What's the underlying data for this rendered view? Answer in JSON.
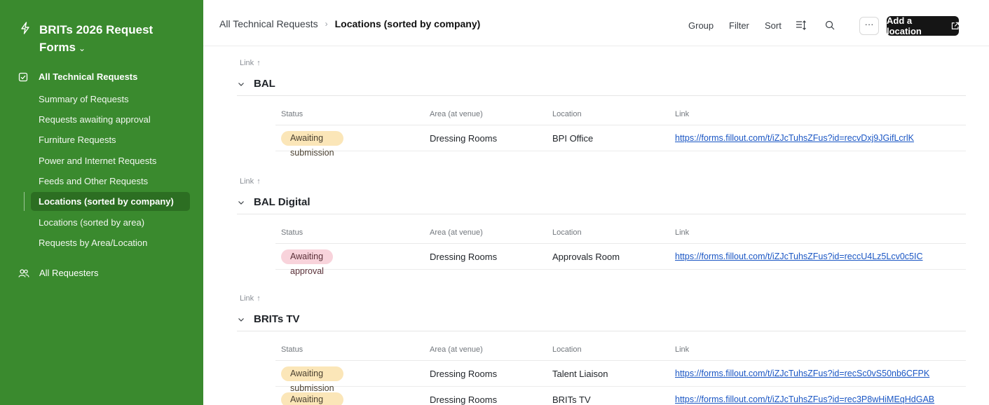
{
  "sidebar": {
    "app_title": "BRITs 2026 Request Forms",
    "app_caret": "⌄",
    "section_title": "All Technical Requests",
    "items": [
      {
        "label": "Summary of Requests"
      },
      {
        "label": "Requests awaiting approval"
      },
      {
        "label": "Furniture Requests"
      },
      {
        "label": "Power and Internet Requests"
      },
      {
        "label": "Feeds and Other Requests"
      },
      {
        "label": "Locations (sorted by company)"
      },
      {
        "label": "Locations (sorted by area)"
      },
      {
        "label": "Requests by Area/Location"
      }
    ],
    "active_item": "Locations (sorted by company)",
    "requesters_label": "All Requesters",
    "colors": {
      "background": "#3a8a2e",
      "active": "#2c6e22"
    }
  },
  "header": {
    "breadcrumb_parent": "All Technical Requests",
    "breadcrumb_current": "Locations (sorted by company)",
    "toolbar": {
      "group": "Group",
      "filter": "Filter",
      "sort": "Sort",
      "more": "···",
      "add": "Add a location"
    }
  },
  "columns": {
    "status": "Status",
    "area": "Area (at venue)",
    "location": "Location",
    "link": "Link"
  },
  "group_sort_label": "Link",
  "groups": [
    {
      "name": "BAL",
      "rows": [
        {
          "status": "Awaiting submission",
          "area": "Dressing Rooms",
          "location": "BPI Office",
          "link": "https://forms.fillout.com/t/iZJcTuhsZFus?id=recvDxj9JGifLcrlK"
        }
      ]
    },
    {
      "name": "BAL Digital",
      "rows": [
        {
          "status": "Awaiting approval",
          "area": "Dressing Rooms",
          "location": "Approvals Room",
          "link": "https://forms.fillout.com/t/iZJcTuhsZFus?id=reccU4Lz5Lcv0c5IC"
        }
      ]
    },
    {
      "name": "BRITs TV",
      "rows": [
        {
          "status": "Awaiting submission",
          "area": "Dressing Rooms",
          "location": "Talent Liaison",
          "link": "https://forms.fillout.com/t/iZJcTuhsZFus?id=recSc0vS50nb6CFPK"
        },
        {
          "status": "Awaiting submission",
          "area": "Dressing Rooms",
          "location": "BRITs TV",
          "link": "https://forms.fillout.com/t/iZJcTuhsZFus?id=rec3P8wHiMEqHdGAB"
        }
      ]
    }
  ],
  "colors": {
    "awaiting_submission": "#fbe6b8",
    "awaiting_approval": "#f8d3db",
    "link": "#1a56c4",
    "add_button": "#151515"
  }
}
